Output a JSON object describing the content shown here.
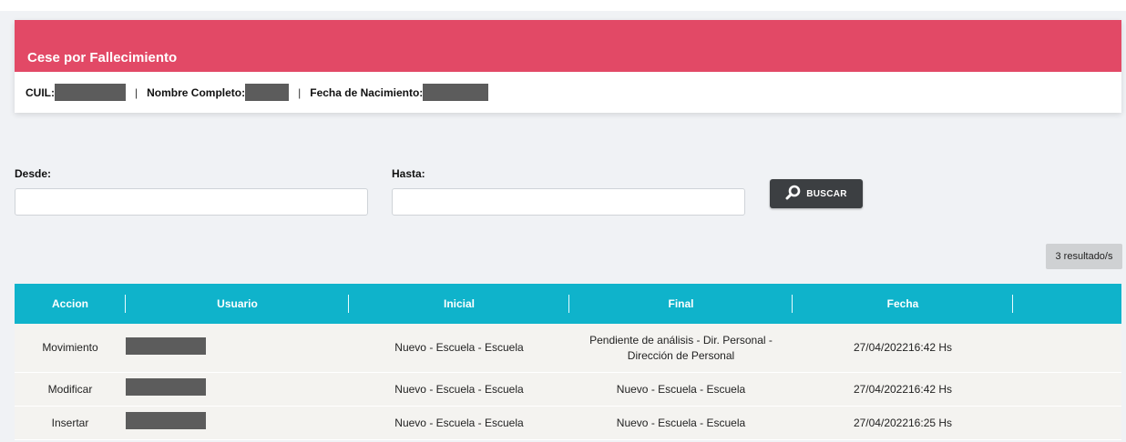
{
  "header": {
    "title": "Cese por Fallecimiento",
    "cuil_label": "CUIL:",
    "nombre_label": "Nombre Completo:",
    "fecha_label": "Fecha de Nacimiento:",
    "separator": "|"
  },
  "filters": {
    "desde_label": "Desde:",
    "desde_value": "",
    "hasta_label": "Hasta:",
    "hasta_value": "",
    "buscar_label": "BUSCAR"
  },
  "results_badge": "3 resultado/s",
  "table": {
    "columns": [
      "Accion",
      "Usuario",
      "Inicial",
      "Final",
      "Fecha"
    ],
    "rows": [
      {
        "accion": "Movimiento",
        "inicial": "Nuevo - Escuela - Escuela",
        "final_line1": "Pendiente de análisis - Dir. Personal -",
        "final_line2": "Dirección de Personal",
        "fecha": "27/04/202216:42 Hs"
      },
      {
        "accion": "Modificar",
        "inicial": "Nuevo - Escuela - Escuela",
        "final": "Nuevo - Escuela - Escuela",
        "fecha": "27/04/202216:42 Hs"
      },
      {
        "accion": "Insertar",
        "inicial": "Nuevo - Escuela - Escuela",
        "final": "Nuevo - Escuela - Escuela",
        "fecha": "27/04/202216:25 Hs"
      }
    ]
  },
  "colors": {
    "header_bg": "#e24966",
    "table_header_bg": "#0fb3cb",
    "button_bg": "#3c3f42",
    "page_bg": "#f0f2f5"
  },
  "icons": {
    "buscar": "search-icon"
  }
}
